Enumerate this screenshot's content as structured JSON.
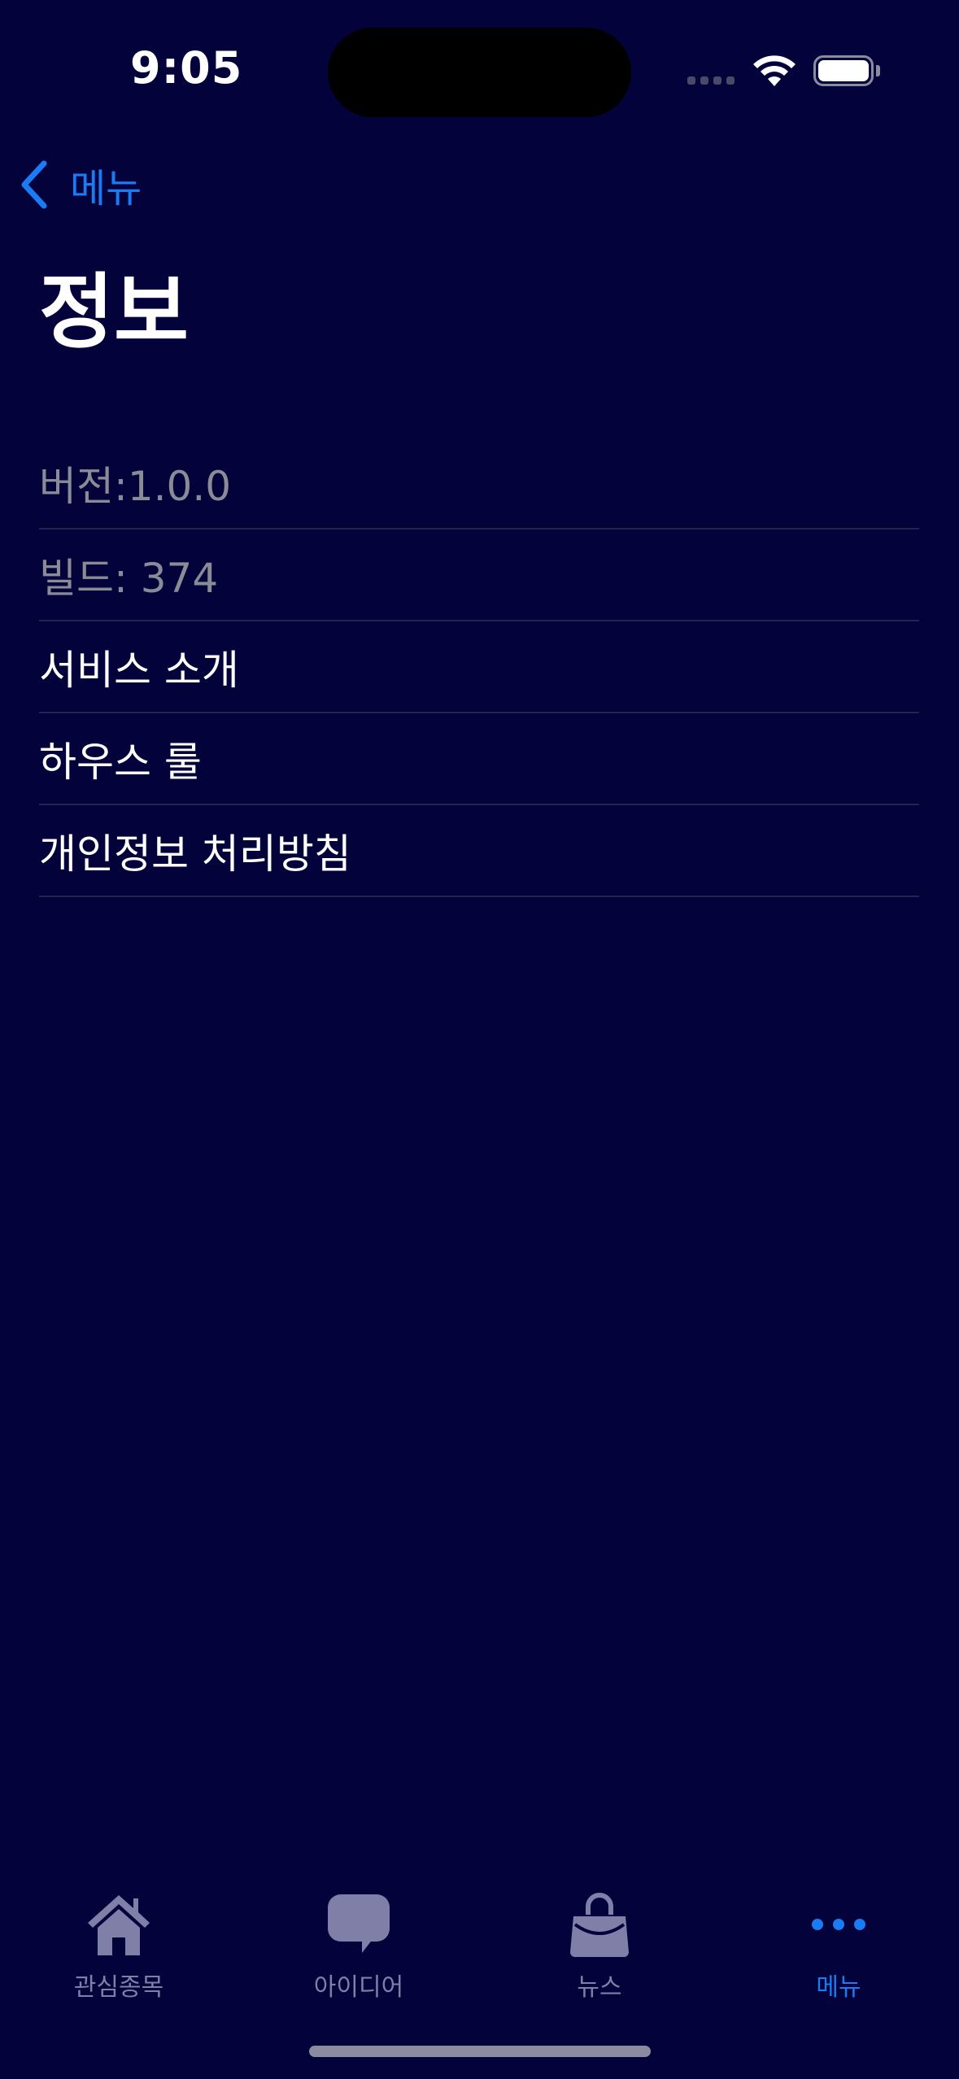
{
  "status_bar": {
    "time": "9:05"
  },
  "nav": {
    "back_label": "메뉴",
    "title": "정보"
  },
  "list": {
    "version": "버전:1.0.0",
    "build": "빌드: 374",
    "items": [
      "서비스 소개",
      "하우스 룰",
      "개인정보 처리방침"
    ]
  },
  "tabbar": {
    "tabs": [
      {
        "label": "관심종목",
        "icon": "house-icon"
      },
      {
        "label": "아이디어",
        "icon": "speech-bubble-icon"
      },
      {
        "label": "뉴스",
        "icon": "bag-icon"
      },
      {
        "label": "메뉴",
        "icon": "ellipsis-icon",
        "active": true
      }
    ]
  },
  "colors": {
    "background": "#03023a",
    "accent": "#1a7cf5",
    "inactive": "#7f7fa8",
    "muted_text": "#8b8b97"
  }
}
